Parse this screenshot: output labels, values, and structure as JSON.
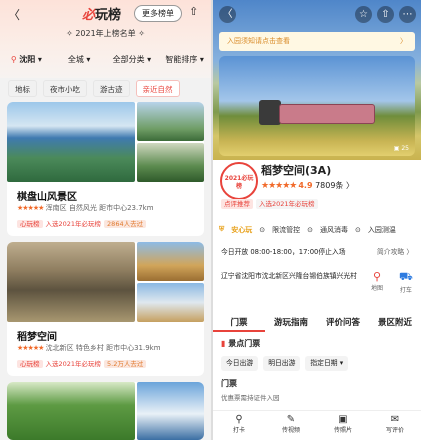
{
  "left": {
    "back": "〈",
    "logo_mark": "必",
    "logo_text": "玩榜",
    "more_label": "更多榜单",
    "year_title": "2021年上榜名单",
    "filters": {
      "city": "沈阳",
      "all": "全城",
      "category": "全部分类",
      "sort": "智能排序"
    },
    "tags": [
      "地标",
      "夜市小吃",
      "游古迹",
      "亲近自然"
    ],
    "cards": [
      {
        "title": "棋盘山风景区",
        "stars": "★★★★★",
        "meta": "浑南区 自然风光 距市中心23.7km",
        "badge": "心玩榜",
        "badge_text": "入选2021年必玩榜",
        "visited": "2864人去过"
      },
      {
        "title": "稻梦空间",
        "stars": "★★★★★",
        "meta": "沈北新区 特色乡村 距市中心31.9km",
        "badge": "心玩榜",
        "badge_text": "入选2021年必玩榜",
        "visited": "5.2万人去过"
      }
    ]
  },
  "right": {
    "notice": "入园须知请点击查看",
    "photo_count": "25",
    "logo_text": "2021必玩榜",
    "name": "稻梦空间(3A)",
    "stars": "★★★★★",
    "rating": "4.9",
    "reviews": "7809条",
    "badge": "点评推荐",
    "badge_text": "入选2021年必玩榜",
    "safety": [
      "安心玩",
      "限流管控",
      "通风消毒",
      "入园测温"
    ],
    "hours": "今日开放 08:00-18:00，17:00停止入场",
    "intro": "简介攻略 〉",
    "address": "辽宁省沈阳市沈北新区兴隆台锡伯族镇兴光村",
    "map_label": "地图",
    "taxi_label": "打车",
    "tabs": [
      "门票",
      "游玩指南",
      "评价问答",
      "景区附近"
    ],
    "section": "景点门票",
    "pills": [
      "今日出游",
      "明日出游",
      "指定日期 ▾"
    ],
    "ticket_heading": "门票",
    "ticket_sub": "优惠票需持证件入园",
    "bottom": [
      {
        "icon": "⚲",
        "label": "打卡"
      },
      {
        "icon": "✎",
        "label": "传视频"
      },
      {
        "icon": "▣",
        "label": "传照片"
      },
      {
        "icon": "✉",
        "label": "写评价"
      }
    ]
  }
}
